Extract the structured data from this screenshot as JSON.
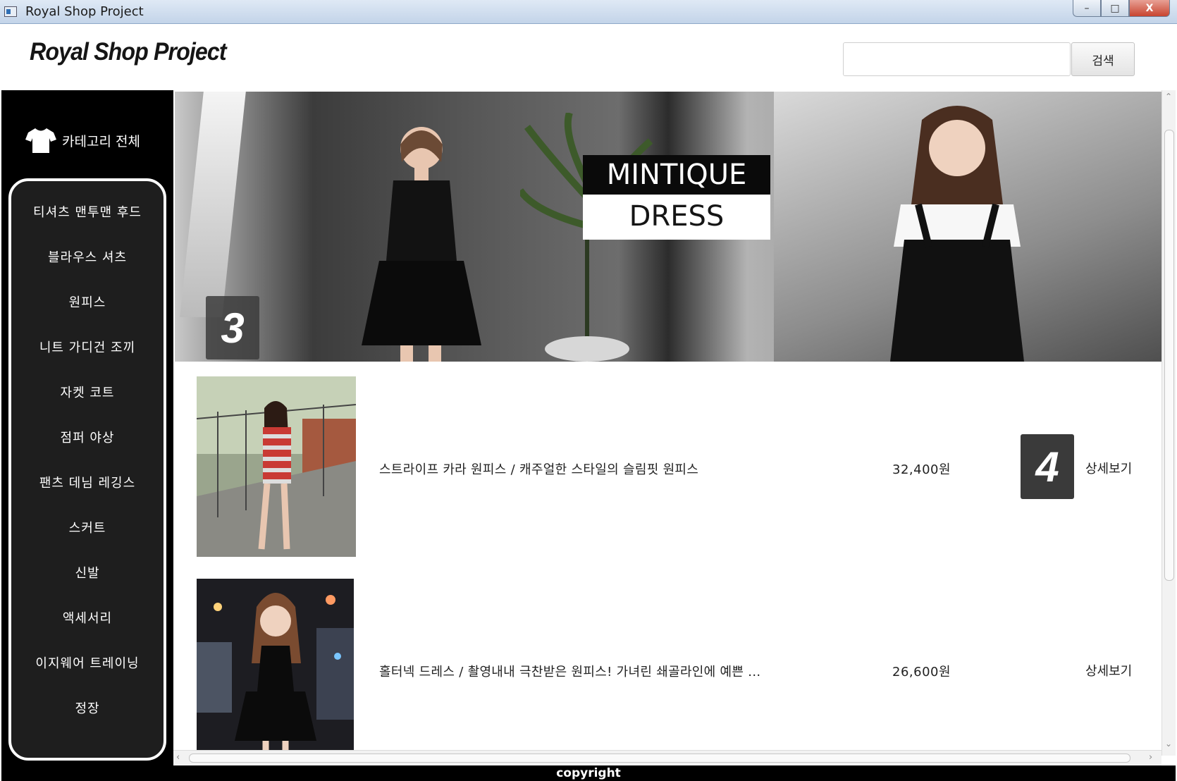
{
  "window": {
    "title": "Royal Shop Project",
    "minimize": "–",
    "maximize": "□",
    "close": "X"
  },
  "header": {
    "logo": "Royal Shop Project",
    "search_placeholder": "",
    "search_button": "검색"
  },
  "sidebar": {
    "category_all": "카테고리 전체",
    "icon": "tshirt-icon",
    "items": [
      {
        "label": "티셔츠 맨투맨 후드"
      },
      {
        "label": "블라우스 셔츠"
      },
      {
        "label": "원피스"
      },
      {
        "label": "니트 가디건 조끼"
      },
      {
        "label": "자켓 코트"
      },
      {
        "label": "점퍼 야상"
      },
      {
        "label": "팬츠 데님 레깅스"
      },
      {
        "label": "스커트"
      },
      {
        "label": "신발"
      },
      {
        "label": "액세서리"
      },
      {
        "label": "이지웨어 트레이닝"
      },
      {
        "label": "정장"
      }
    ]
  },
  "banner": {
    "brand_line1": "MINTIQUE",
    "brand_line2": "DRESS",
    "badge": "3"
  },
  "products": [
    {
      "name": "스트라이프 카라 원피스 / 캐주얼한 스타일의 슬림핏 원피스",
      "price": "32,400원",
      "detail": "상세보기",
      "badge": "4"
    },
    {
      "name": "홀터넥 드레스 / 촬영내내 극찬받은 원피스! 가녀린 쇄골라인에 예쁜 ...",
      "price": "26,600원",
      "detail": "상세보기"
    }
  ],
  "footer": {
    "text": "copyright"
  },
  "colors": {
    "sidebar_bg": "#000000",
    "menu_bg": "#1e1e1e",
    "accent_badge": "#3a3a3a"
  }
}
